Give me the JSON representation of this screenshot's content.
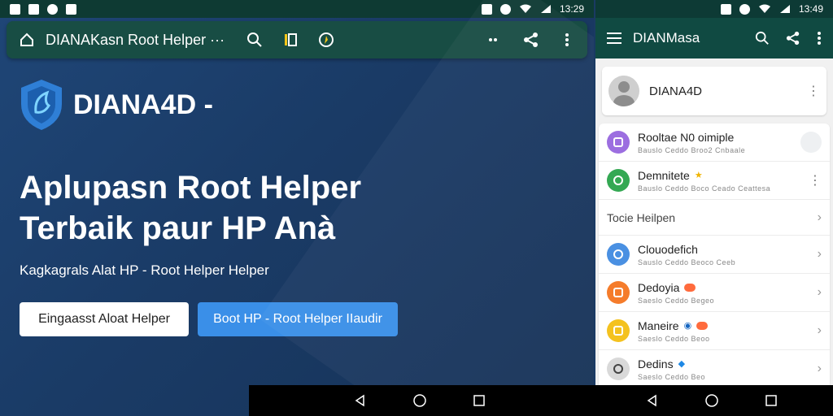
{
  "left": {
    "status": {
      "time": "13:29"
    },
    "toolbar": {
      "title": "DIANAKasn Root Helper ···"
    },
    "brand": {
      "name": "DIANA4D -"
    },
    "hero": {
      "line1": "Aplupasn Root Helper",
      "line2": "Terbaik paur HP Anà",
      "subtitle": "Kagkagrals Alat HP - Root Helper Helper"
    },
    "buttons": {
      "primary_white": "Eingaasst Aloat Helper",
      "primary_blue": "Boot HP - Root Helper IIaudir"
    }
  },
  "right": {
    "status": {
      "time": "13:49"
    },
    "toolbar": {
      "title": "DIANMasa"
    },
    "profile": {
      "name": "DIANA4D"
    },
    "items": [
      {
        "title": "Rooltae N0 oimiple",
        "sub": "Bauslo Ceddo Broo2 Cnbaale",
        "color": "#9c6ee0"
      },
      {
        "title": "Demnitete",
        "sub": "Bauslo Ceddo Boco Ceado Ceattesa",
        "color": "#34a853"
      }
    ],
    "section": {
      "title": "Tocie Heilpen"
    },
    "items2": [
      {
        "title": "Clouodefich",
        "sub": "Sauslo Ceddo Beoco Ceeb",
        "color": "#4a90e2"
      },
      {
        "title": "Dedoyia",
        "sub": "Saeslo Ceddo Begeo",
        "color": "#f57c2b"
      },
      {
        "title": "Maneire",
        "sub": "Saeslo Ceddo Beoo",
        "color": "#f4c21f"
      },
      {
        "title": "Dedins",
        "sub": "Saeslo Ceddo Beo",
        "color": "#d9d9d9"
      }
    ]
  },
  "colors": {
    "left_bg": "#1a3b66",
    "toolbar": "#184d44",
    "accent_blue": "#3a8fe8"
  }
}
